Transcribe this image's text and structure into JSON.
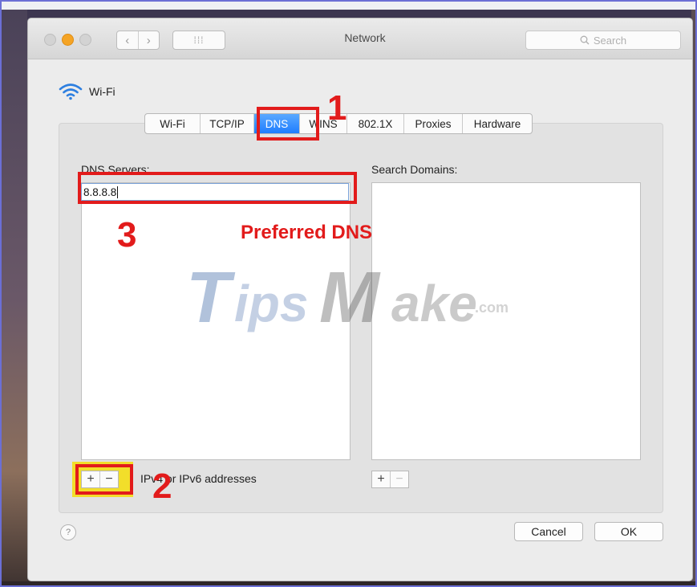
{
  "window": {
    "title": "Network",
    "search_placeholder": "Search",
    "nav_back": "‹",
    "nav_forward": "›",
    "grid_icon_glyph": "⁞⁞⁞"
  },
  "interface": {
    "name": "Wi-Fi"
  },
  "tabs": [
    {
      "label": "Wi-Fi"
    },
    {
      "label": "TCP/IP"
    },
    {
      "label": "DNS",
      "active": true
    },
    {
      "label": "WINS"
    },
    {
      "label": "802.1X"
    },
    {
      "label": "Proxies"
    },
    {
      "label": "Hardware"
    }
  ],
  "dns_servers": {
    "label": "DNS Servers:",
    "entries": [
      "8.8.8.8"
    ]
  },
  "search_domains": {
    "label": "Search Domains:",
    "entries": []
  },
  "controls": {
    "add": "+",
    "remove": "−",
    "address_hint": "IPv4 or IPv6 addresses"
  },
  "footer": {
    "help": "?",
    "cancel": "Cancel",
    "ok": "OK"
  },
  "annotations": {
    "step1": "1",
    "step2": "2",
    "step3": "3",
    "preferred_label": "Preferred DNS",
    "color": "#e21b1b",
    "highlight_color": "#f2de2a"
  },
  "watermark": {
    "t": "T",
    "ips": "ips",
    "m": "M",
    "ake": "ake",
    "com": ".com"
  },
  "colors": {
    "accent_tab": "#1e7dff",
    "traffic_yellow": "#f5a425"
  }
}
